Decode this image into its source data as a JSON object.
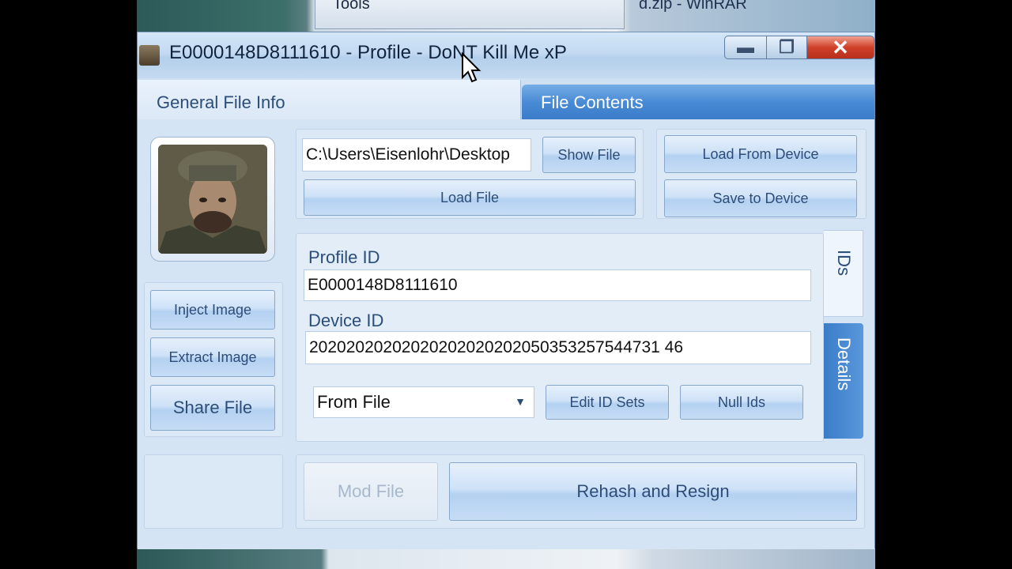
{
  "background": {
    "tools_label": "Tools",
    "winrar_label": "d.zip - WinRAR"
  },
  "window": {
    "title": "E0000148D8111610 - Profile - DoNT Kill Me xP",
    "minimize_symbol": "▬",
    "maximize_symbol": "❐",
    "close_symbol": "✕"
  },
  "tabs": {
    "general": "General File Info",
    "contents": "File Contents"
  },
  "file": {
    "path_value": "C:\\Users\\Eisenlohr\\Desktop",
    "show_file": "Show File",
    "load_file": "Load File"
  },
  "device": {
    "load_from_device": "Load From Device",
    "save_to_device": "Save to Device"
  },
  "image_buttons": {
    "inject": "Inject Image",
    "extract": "Extract Image",
    "share": "Share File"
  },
  "ids": {
    "profile_label": "Profile ID",
    "profile_value": "E0000148D8111610",
    "device_label": "Device ID",
    "device_value": "20202020202020202020202050353257544731 46",
    "source_select": "From File",
    "edit_id_sets": "Edit ID Sets",
    "null_ids": "Null Ids",
    "side_tab_ids": "IDs",
    "side_tab_details": "Details"
  },
  "actions": {
    "mod_file": "Mod File",
    "rehash": "Rehash and Resign"
  },
  "colors": {
    "accent": "#3a7cc8",
    "close": "#c83a24"
  }
}
